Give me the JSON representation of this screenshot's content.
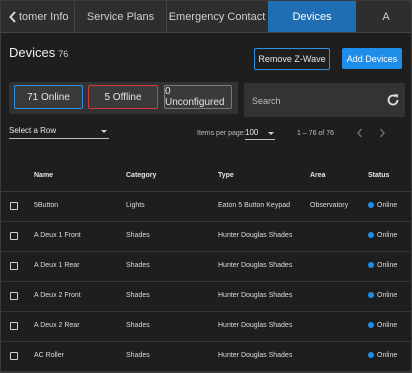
{
  "colors": {
    "accent": "#1f8ee8",
    "online": "#1f8ee8",
    "offline": "#d33a3a"
  },
  "tabs": [
    {
      "label": "tomer Info",
      "active": false
    },
    {
      "label": "Service Plans",
      "active": false
    },
    {
      "label": "Emergency Contact",
      "active": false
    },
    {
      "label": "Devices",
      "active": true
    },
    {
      "label": "A",
      "active": false
    }
  ],
  "tab_icons": {
    "prev": "chevron-left-icon",
    "next": "chevron-right-icon"
  },
  "header": {
    "title": "Devices",
    "count": "76"
  },
  "actions": {
    "remove_zwave": "Remove Z-Wave",
    "add_devices": "Add Devices"
  },
  "filters": {
    "online": "71 Online",
    "offline": "5 Offline",
    "unconfigured": "0 Unconfigured"
  },
  "search": {
    "placeholder": "Search",
    "icon": "refresh-icon"
  },
  "select_row": {
    "label": "Select a Row"
  },
  "pagination": {
    "items_label": "Items per page:",
    "per_page": "100",
    "range": "1 – 76 of 76"
  },
  "columns": {
    "name": "Name",
    "category": "Category",
    "type": "Type",
    "area": "Area",
    "status": "Status"
  },
  "rows": [
    {
      "name": "5Button",
      "category": "Lights",
      "type": "Eaton 5 Button Keypad",
      "area": "Observatory",
      "status": "Online"
    },
    {
      "name": "A Deux 1 Front",
      "category": "Shades",
      "type": "Hunter Douglas Shades",
      "area": "",
      "status": "Online"
    },
    {
      "name": "A Deux 1 Rear",
      "category": "Shades",
      "type": "Hunter Douglas Shades",
      "area": "",
      "status": "Online"
    },
    {
      "name": "A Deux 2 Front",
      "category": "Shades",
      "type": "Hunter Douglas Shades",
      "area": "",
      "status": "Online"
    },
    {
      "name": "A Deux 2 Rear",
      "category": "Shades",
      "type": "Hunter Douglas Shades",
      "area": "",
      "status": "Online"
    },
    {
      "name": "AC Roller",
      "category": "Shades",
      "type": "Hunter Douglas Shades",
      "area": "",
      "status": "Online"
    }
  ]
}
